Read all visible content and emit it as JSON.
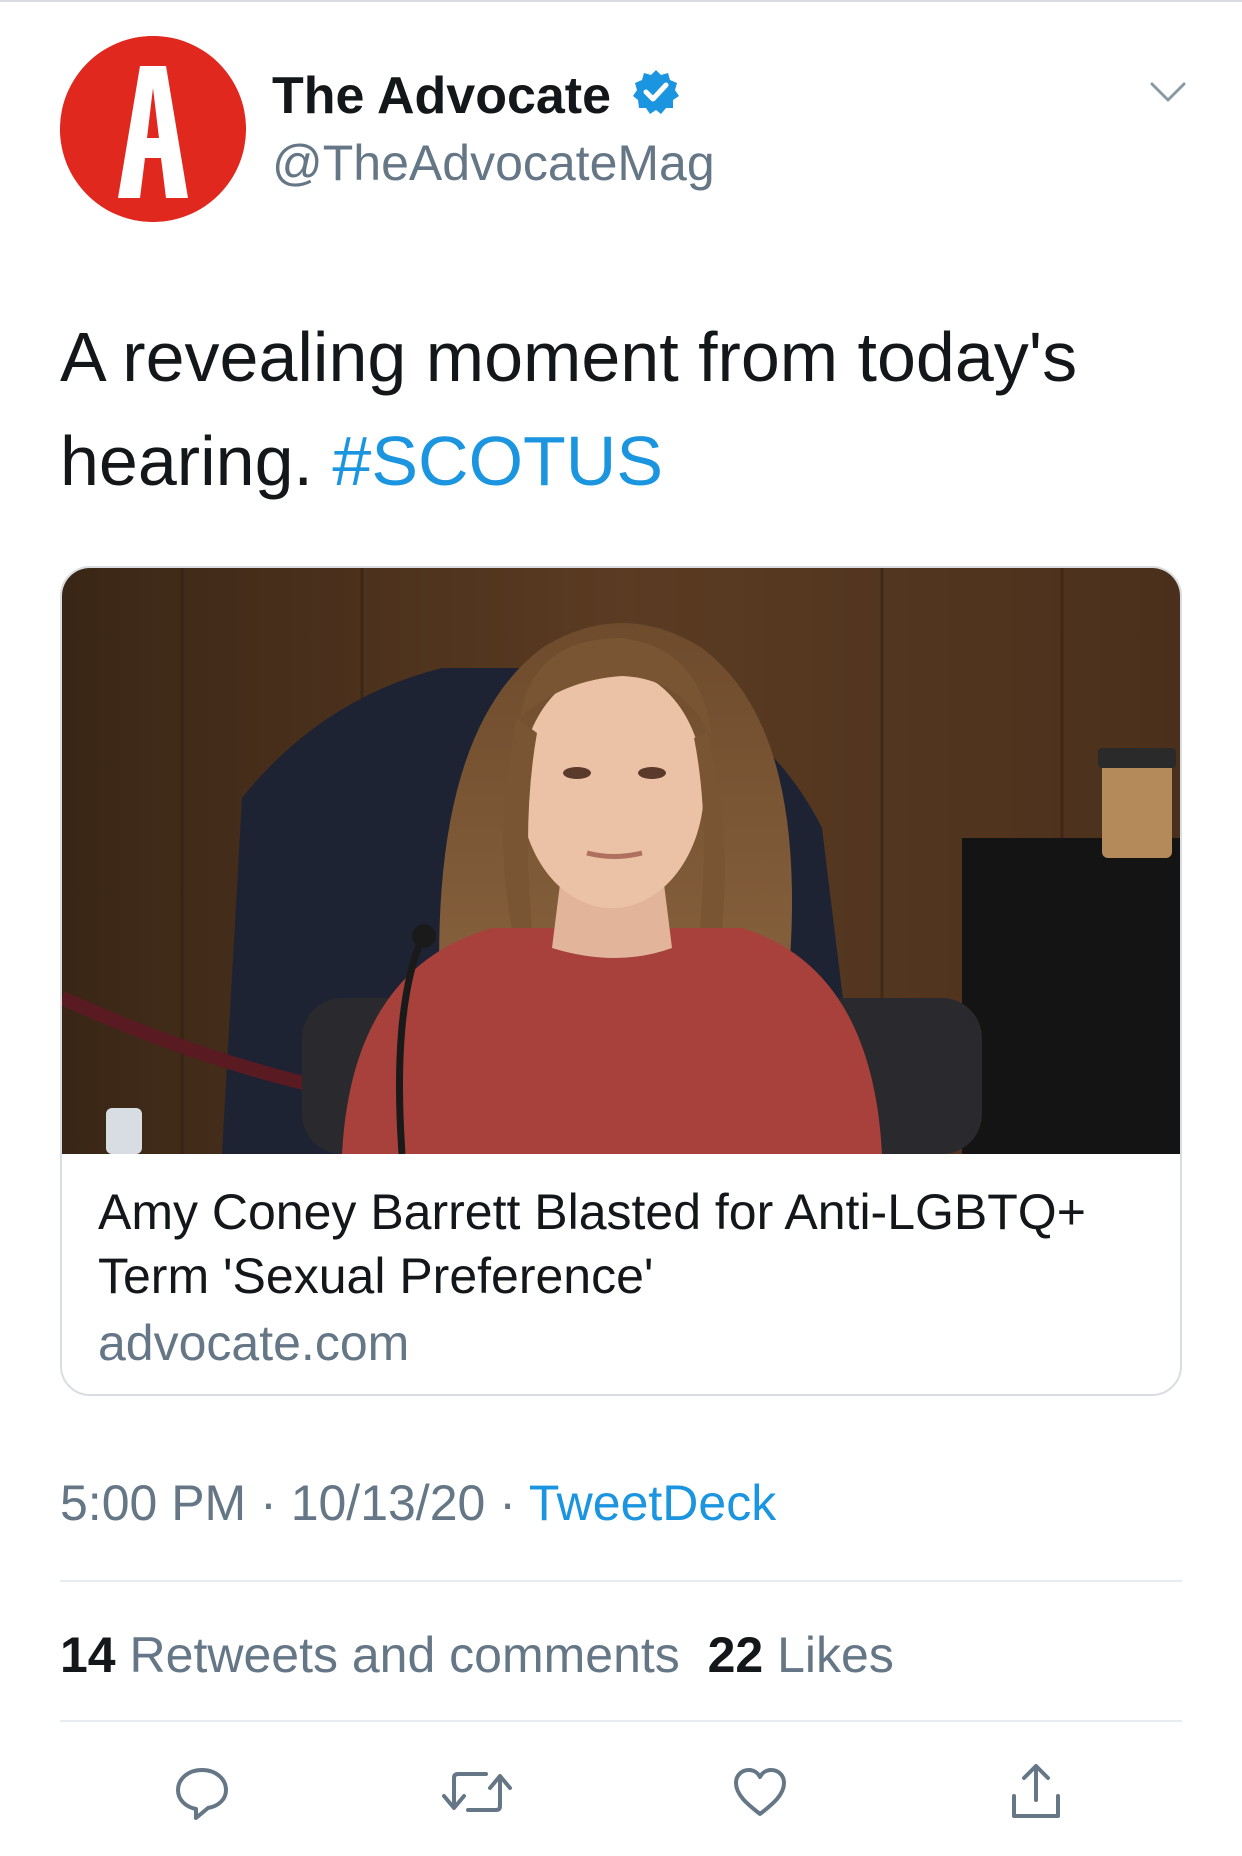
{
  "header": {
    "avatar_letter": "A",
    "display_name": "The Advocate",
    "handle": "@TheAdvocateMag",
    "verified": true
  },
  "tweet": {
    "text": "A revealing moment from today's hearing.",
    "hashtag": "#SCOTUS"
  },
  "card": {
    "title": "Amy Coney Barrett Blasted for Anti-LGBTQ+ Term 'Sexual Preference'",
    "domain": "advocate.com"
  },
  "meta": {
    "time": "5:00 PM",
    "date": "10/13/20",
    "separator": "·",
    "source": "TweetDeck"
  },
  "stats": {
    "retweets_count": "14",
    "retweets_label": "Retweets and comments",
    "likes_count": "22",
    "likes_label": "Likes"
  },
  "actions": [
    "reply-icon",
    "retweet-icon",
    "like-icon",
    "share-icon"
  ],
  "colors": {
    "accent": "#1b95e0",
    "brand": "#e0281f",
    "secondary_text": "#657786",
    "primary_text": "#14171a"
  }
}
